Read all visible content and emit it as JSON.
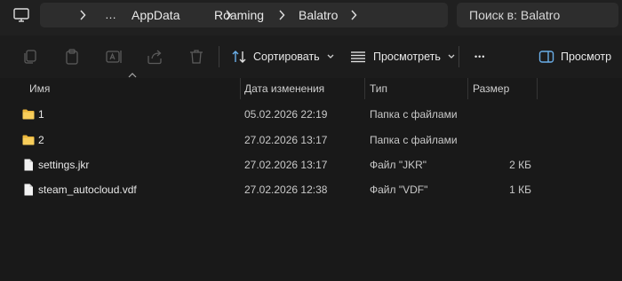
{
  "address": {
    "more": "…",
    "path": [
      "AppData",
      "Roaming",
      "Balatro"
    ],
    "search_placeholder": "Поиск в: Balatro"
  },
  "toolbar": {
    "sort_label": "Сортировать",
    "view_label": "Просмотреть",
    "more_label": "•••",
    "preview_label": "Просмотр"
  },
  "columns": {
    "name": "Имя",
    "date": "Дата изменения",
    "type": "Тип",
    "size": "Размер"
  },
  "files": [
    {
      "name": "1",
      "date": "05.02.2026 22:19",
      "type": "Папка с файлами",
      "size": "",
      "icon": "folder-icon"
    },
    {
      "name": "2",
      "date": "27.02.2026 13:17",
      "type": "Папка с файлами",
      "size": "",
      "icon": "folder-icon"
    },
    {
      "name": "settings.jkr",
      "date": "27.02.2026 13:17",
      "type": "Файл \"JKR\"",
      "size": "2 КБ",
      "icon": "file-icon"
    },
    {
      "name": "steam_autocloud.vdf",
      "date": "27.02.2026 12:38",
      "type": "Файл \"VDF\"",
      "size": "1 КБ",
      "icon": "file-icon"
    }
  ],
  "colors": {
    "background": "#191919",
    "address_bar": "#202020",
    "field": "#2d2d2d",
    "folder": "#f2c14e",
    "accent": "#4ca0e0"
  }
}
